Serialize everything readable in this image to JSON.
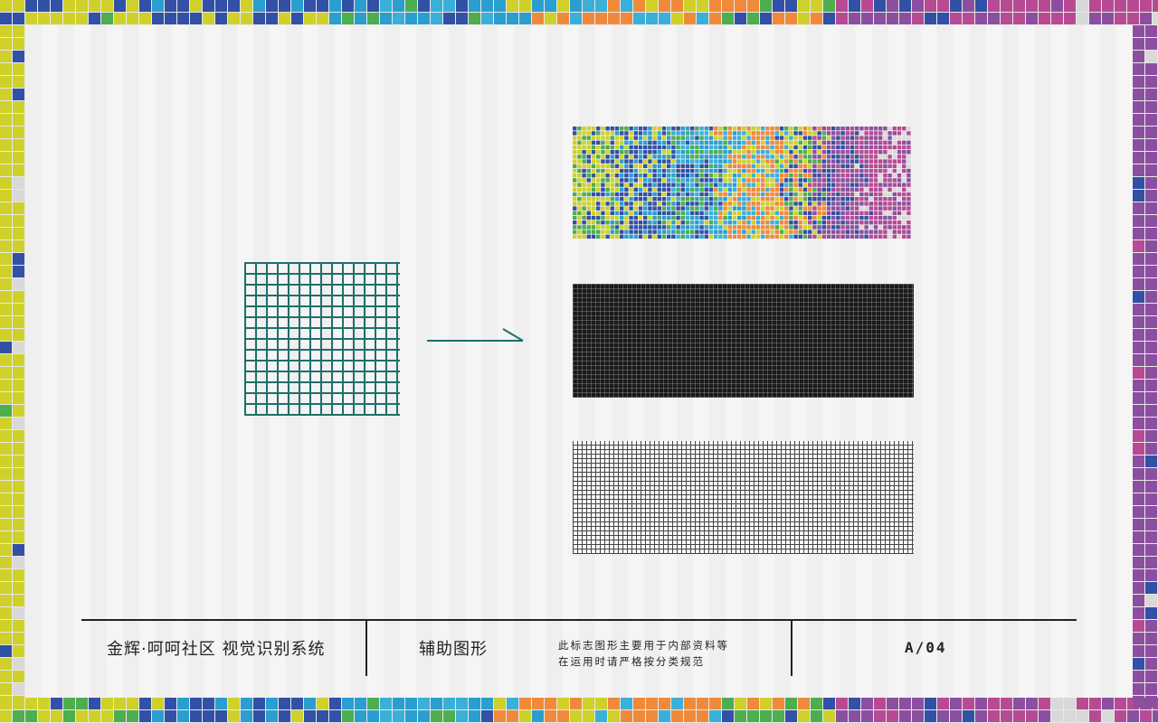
{
  "footer": {
    "title": "金辉·呵呵社区 视觉识别系统",
    "section": "辅助图形",
    "note_line1": "此标志图形主要用于内部资料等",
    "note_line2": "在运用时请严格按分类规范",
    "page_code": "A/04"
  },
  "graphics": {
    "source_grid_color": "#1f6f6a",
    "arrow_color": "#1f6f6a",
    "mosaic_palette": [
      "#cfd12a",
      "#3150a6",
      "#2a9fcf",
      "#3ab0d9",
      "#f08a3a",
      "#4cae4f",
      "#8c4fa0",
      "#b84a93",
      "#d9d9d9"
    ],
    "dark_mosaic_color": "#1a1a1a",
    "light_mosaic_color": "#fafafa"
  }
}
